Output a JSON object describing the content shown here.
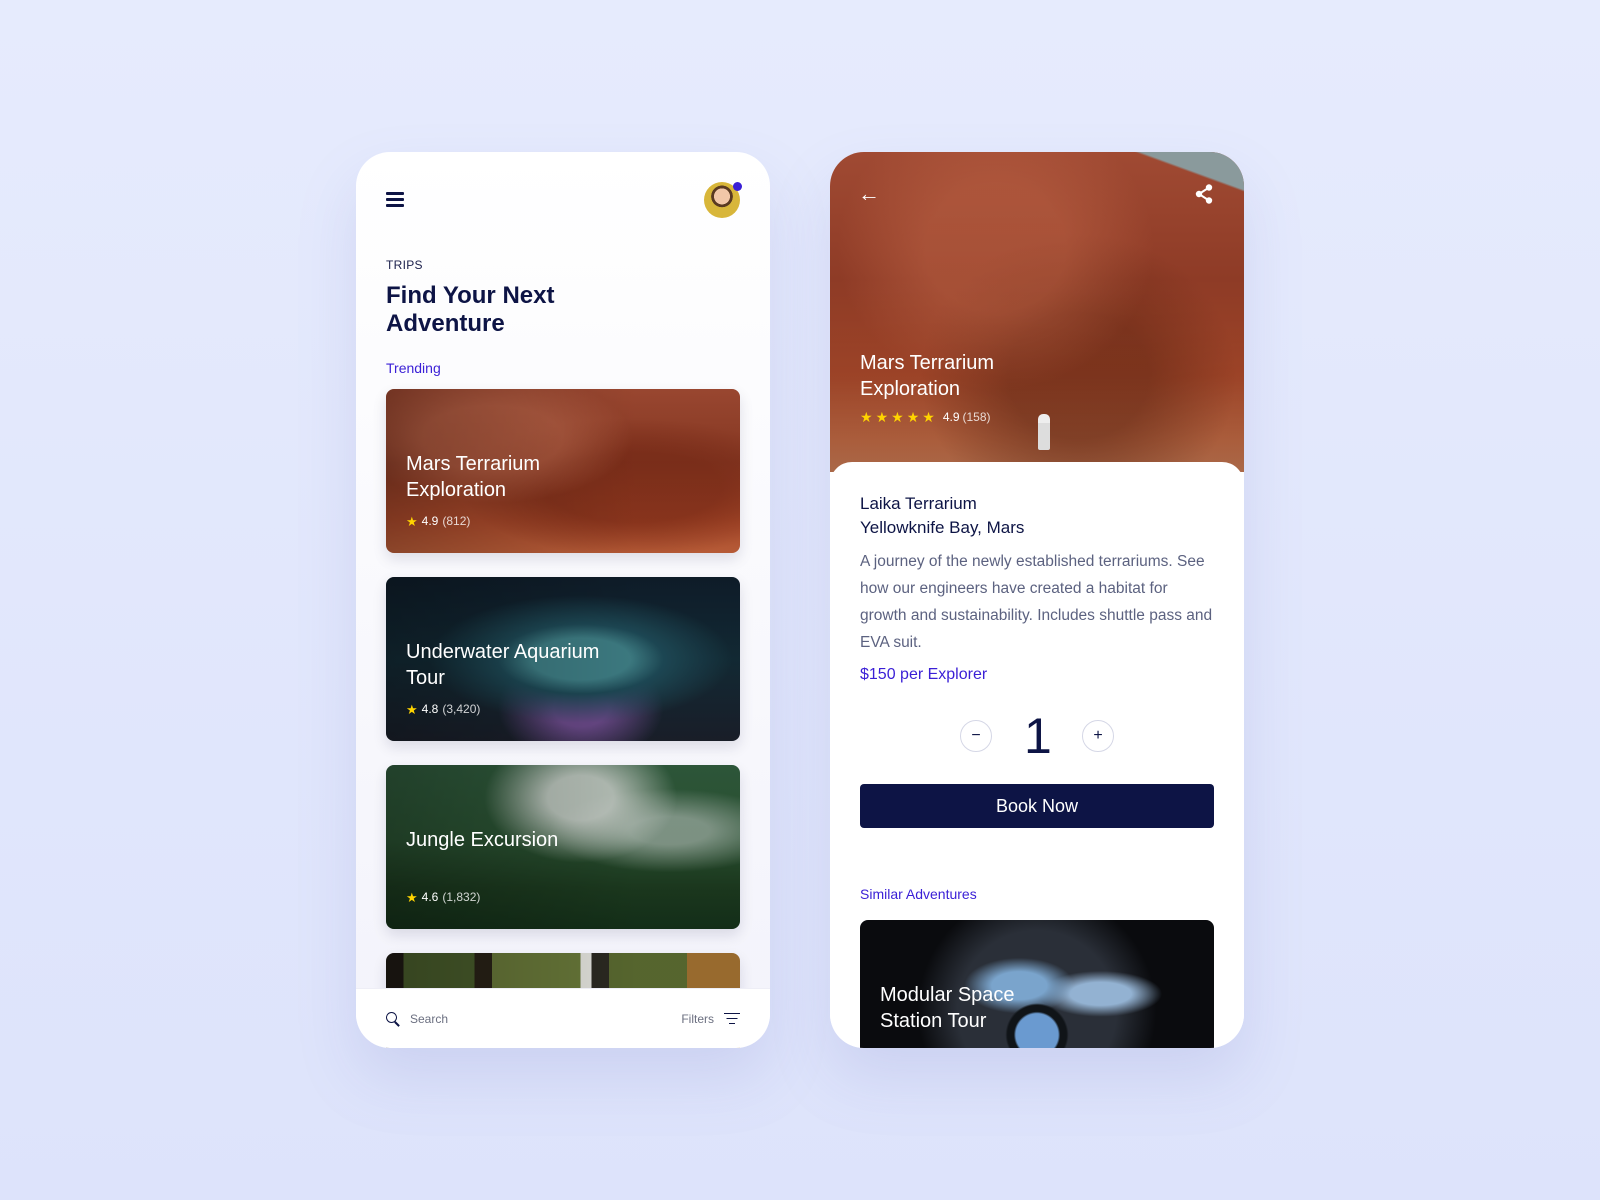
{
  "trips_screen": {
    "eyebrow": "TRIPS",
    "title": "Find Your Next Adventure",
    "section_label": "Trending",
    "cards": [
      {
        "title": "Mars Terrarium Exploration",
        "rating": "4.9",
        "count": "(812)",
        "image": "mars-canyon"
      },
      {
        "title": "Underwater Aquarium Tour",
        "rating": "4.8",
        "count": "(3,420)",
        "image": "aquarium-tunnel"
      },
      {
        "title": "Jungle Excursion",
        "rating": "4.6",
        "count": "(1,832)",
        "image": "misty-jungle"
      },
      {
        "title": "",
        "rating": "",
        "count": "",
        "image": "forest"
      }
    ],
    "bottom_bar": {
      "search_placeholder": "Search",
      "filters_label": "Filters"
    },
    "avatar": {
      "has_notification": true
    }
  },
  "detail_screen": {
    "hero": {
      "title": "Mars Terrarium Exploration",
      "stars": 5,
      "rating": "4.9",
      "count": "(158)"
    },
    "place_name_line1": "Laika Terrarium",
    "place_name_line2": "Yellowknife Bay, Mars",
    "description": "A journey of the newly established terrariums. See how our engineers have created a habitat for growth and sustainability. Includes shuttle pass and EVA suit.",
    "price": "$150 per Explorer",
    "quantity": "1",
    "decrement_symbol": "−",
    "increment_symbol": "+",
    "book_label": "Book Now",
    "similar_label": "Similar Adventures",
    "similar_cards": [
      {
        "title": "Modular Space Station Tour",
        "image": "space-station-cupola"
      }
    ]
  },
  "icons": {
    "back": "←",
    "star": "★"
  },
  "colors": {
    "primary_navy": "#0d1445",
    "accent_indigo": "#3a1fd6",
    "star_yellow": "#ffd400",
    "background": "#e6ebfd"
  }
}
